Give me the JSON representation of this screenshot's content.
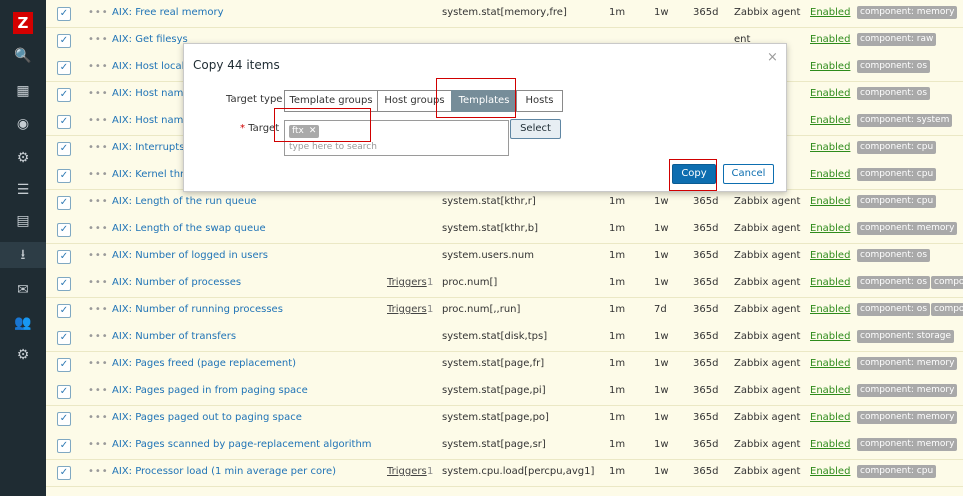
{
  "sidebar": {
    "logo": "Z",
    "nav": [
      {
        "icon": "search-icon",
        "glyph": "🔍"
      },
      {
        "icon": "dashboard-icon",
        "glyph": "▦"
      },
      {
        "icon": "monitoring-eye-icon",
        "glyph": "◉"
      },
      {
        "icon": "network-icon",
        "glyph": "⚙"
      },
      {
        "icon": "list-icon",
        "glyph": "☰"
      },
      {
        "icon": "reports-icon",
        "glyph": "▤"
      },
      {
        "icon": "data-collection-icon",
        "glyph": "⭳"
      },
      {
        "icon": "alerts-mail-icon",
        "glyph": "✉"
      },
      {
        "icon": "users-icon",
        "glyph": "👥"
      },
      {
        "icon": "administration-gear-icon",
        "glyph": "⚙"
      }
    ]
  },
  "rows": [
    {
      "name": "AIX: Free real memory",
      "trig": "",
      "trigc": "",
      "key": "system.stat[memory,fre]",
      "intv": "1m",
      "hist": "1w",
      "trend": "365d",
      "type": "Zabbix agent",
      "status": "Enabled",
      "tags": [
        "component: memory"
      ]
    },
    {
      "name": "AIX: Get filesys",
      "trig": "",
      "trigc": "",
      "key": "",
      "intv": "",
      "hist": "",
      "trend": "",
      "type": "ent",
      "status": "Enabled",
      "tags": [
        "component: raw"
      ]
    },
    {
      "name": "AIX: Host local",
      "trig": "",
      "trigc": "",
      "key": "",
      "intv": "",
      "hist": "",
      "trend": "",
      "type": "ent",
      "status": "Enabled",
      "tags": [
        "component: os"
      ]
    },
    {
      "name": "AIX: Host name",
      "trig": "",
      "trigc": "",
      "key": "",
      "intv": "",
      "hist": "",
      "trend": "",
      "type": "ent",
      "status": "Enabled",
      "tags": [
        "component: os"
      ]
    },
    {
      "name": "AIX: Host name",
      "trig": "",
      "trigc": "",
      "key": "",
      "intv": "",
      "hist": "",
      "trend": "",
      "type": "ent",
      "status": "Enabled",
      "tags": [
        "component: system"
      ]
    },
    {
      "name": "AIX: Interrupts p",
      "trig": "",
      "trigc": "",
      "key": "",
      "intv": "",
      "hist": "",
      "trend": "",
      "type": "ent",
      "status": "Enabled",
      "tags": [
        "component: cpu"
      ]
    },
    {
      "name": "AIX: Kernel thre",
      "trig": "",
      "trigc": "",
      "key": "",
      "intv": "",
      "hist": "",
      "trend": "",
      "type": "ent",
      "status": "Enabled",
      "tags": [
        "component: cpu"
      ]
    },
    {
      "name": "AIX: Length of the run queue",
      "trig": "",
      "trigc": "",
      "key": "system.stat[kthr,r]",
      "intv": "1m",
      "hist": "1w",
      "trend": "365d",
      "type": "Zabbix agent",
      "status": "Enabled",
      "tags": [
        "component: cpu"
      ]
    },
    {
      "name": "AIX: Length of the swap queue",
      "trig": "",
      "trigc": "",
      "key": "system.stat[kthr,b]",
      "intv": "1m",
      "hist": "1w",
      "trend": "365d",
      "type": "Zabbix agent",
      "status": "Enabled",
      "tags": [
        "component: memory"
      ]
    },
    {
      "name": "AIX: Number of logged in users",
      "trig": "",
      "trigc": "",
      "key": "system.users.num",
      "intv": "1m",
      "hist": "1w",
      "trend": "365d",
      "type": "Zabbix agent",
      "status": "Enabled",
      "tags": [
        "component: os"
      ]
    },
    {
      "name": "AIX: Number of processes",
      "trig": "Triggers",
      "trigc": "1",
      "key": "proc.num[]",
      "intv": "1m",
      "hist": "1w",
      "trend": "365d",
      "type": "Zabbix agent",
      "status": "Enabled",
      "tags": [
        "component: os",
        "compo"
      ]
    },
    {
      "name": "AIX: Number of running processes",
      "trig": "Triggers",
      "trigc": "1",
      "key": "proc.num[,,run]",
      "intv": "1m",
      "hist": "7d",
      "trend": "365d",
      "type": "Zabbix agent",
      "status": "Enabled",
      "tags": [
        "component: os",
        "compo"
      ]
    },
    {
      "name": "AIX: Number of transfers",
      "trig": "",
      "trigc": "",
      "key": "system.stat[disk,tps]",
      "intv": "1m",
      "hist": "1w",
      "trend": "365d",
      "type": "Zabbix agent",
      "status": "Enabled",
      "tags": [
        "component: storage"
      ]
    },
    {
      "name": "AIX: Pages freed (page replacement)",
      "trig": "",
      "trigc": "",
      "key": "system.stat[page,fr]",
      "intv": "1m",
      "hist": "1w",
      "trend": "365d",
      "type": "Zabbix agent",
      "status": "Enabled",
      "tags": [
        "component: memory"
      ]
    },
    {
      "name": "AIX: Pages paged in from paging space",
      "trig": "",
      "trigc": "",
      "key": "system.stat[page,pi]",
      "intv": "1m",
      "hist": "1w",
      "trend": "365d",
      "type": "Zabbix agent",
      "status": "Enabled",
      "tags": [
        "component: memory"
      ]
    },
    {
      "name": "AIX: Pages paged out to paging space",
      "trig": "",
      "trigc": "",
      "key": "system.stat[page,po]",
      "intv": "1m",
      "hist": "1w",
      "trend": "365d",
      "type": "Zabbix agent",
      "status": "Enabled",
      "tags": [
        "component: memory"
      ]
    },
    {
      "name": "AIX: Pages scanned by page-replacement algorithm",
      "trig": "",
      "trigc": "",
      "key": "system.stat[page,sr]",
      "intv": "1m",
      "hist": "1w",
      "trend": "365d",
      "type": "Zabbix agent",
      "status": "Enabled",
      "tags": [
        "component: memory"
      ]
    },
    {
      "name": "AIX: Processor load (1 min average per core)",
      "trig": "Triggers",
      "trigc": "1",
      "key": "system.cpu.load[percpu,avg1]",
      "intv": "1m",
      "hist": "1w",
      "trend": "365d",
      "type": "Zabbix agent",
      "status": "Enabled",
      "tags": [
        "component: cpu"
      ]
    }
  ],
  "dialog": {
    "title": "Copy 44 items",
    "close_glyph": "×",
    "target_type_label": "Target type",
    "segments": [
      "Template groups",
      "Host groups",
      "Templates",
      "Hosts"
    ],
    "selected_segment": "Templates",
    "target_label": "Target",
    "required_mark": "*",
    "chip_label": "ftx",
    "chip_remove": "✕",
    "search_placeholder": "type here to search",
    "select_button": "Select",
    "copy_button": "Copy",
    "cancel_button": "Cancel"
  },
  "colors": {
    "link": "#1f73b6",
    "enabled": "#2e8b1b",
    "primary": "#0d6eb0",
    "tag": "#a9a9a9",
    "highlight": "#d00000"
  }
}
